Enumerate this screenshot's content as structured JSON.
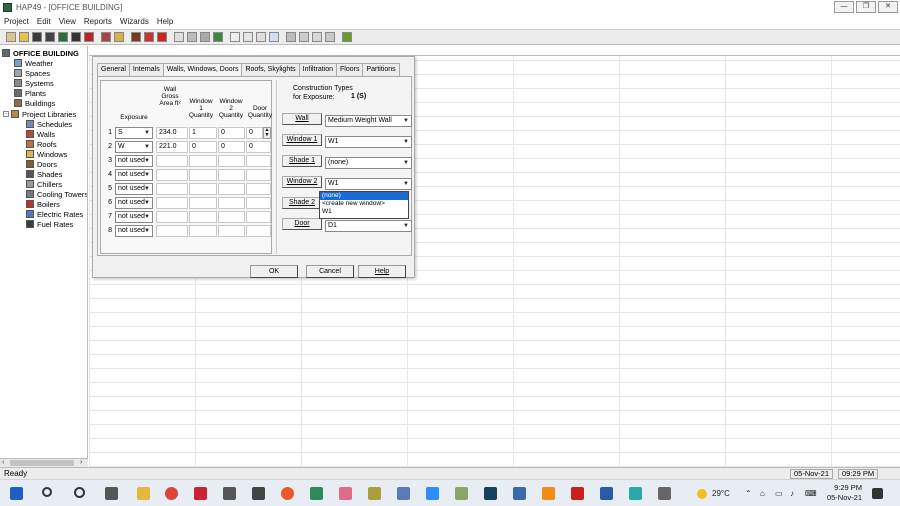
{
  "window": {
    "title": "HAP49 - [OFFICE BUILDING]",
    "min": "—",
    "max": "❐",
    "close": "✕"
  },
  "menu": [
    "Project",
    "Edit",
    "View",
    "Reports",
    "Wizards",
    "Help"
  ],
  "tree": {
    "root": "OFFICE BUILDING",
    "items": [
      "Weather",
      "Spaces",
      "Systems",
      "Plants",
      "Buildings"
    ],
    "libraries_label": "Project Libraries",
    "library_items": [
      "Schedules",
      "Walls",
      "Roofs",
      "Windows",
      "Doors",
      "Shades",
      "Chillers",
      "Cooling Towers",
      "Boilers",
      "Electric Rates",
      "Fuel Rates"
    ]
  },
  "dialog": {
    "tabs": [
      "General",
      "Internals",
      "Walls, Windows, Doors",
      "Roofs, Skylights",
      "Infiltration",
      "Floors",
      "Partitions"
    ],
    "headers": {
      "exposure": "Exposure",
      "wall_area": "Wall Gross Area ft²",
      "window1": "Window 1 Quantity",
      "window2": "Window 2 Quantity",
      "door": "Door Quantity"
    },
    "rows": [
      {
        "num": "1",
        "exposure": "S",
        "area": "234.0",
        "w1": "1",
        "w2": "0",
        "door": "0"
      },
      {
        "num": "2",
        "exposure": "W",
        "area": "221.0",
        "w1": "0",
        "w2": "0",
        "door": "0"
      },
      {
        "num": "3",
        "exposure": "not used",
        "area": "",
        "w1": "",
        "w2": "",
        "door": ""
      },
      {
        "num": "4",
        "exposure": "not used",
        "area": "",
        "w1": "",
        "w2": "",
        "door": ""
      },
      {
        "num": "5",
        "exposure": "not used",
        "area": "",
        "w1": "",
        "w2": "",
        "door": ""
      },
      {
        "num": "6",
        "exposure": "not used",
        "area": "",
        "w1": "",
        "w2": "",
        "door": ""
      },
      {
        "num": "7",
        "exposure": "not used",
        "area": "",
        "w1": "",
        "w2": "",
        "door": ""
      },
      {
        "num": "8",
        "exposure": "not used",
        "area": "",
        "w1": "",
        "w2": "",
        "door": ""
      }
    ],
    "construction": {
      "title_line1": "Construction Types",
      "title_line2": "for Exposure:",
      "exposure_value": "1 (S)",
      "fields": [
        {
          "label": "Wall",
          "value": "Medium Weight Wall"
        },
        {
          "label": "Window 1",
          "value": "W1"
        },
        {
          "label": "Shade 1",
          "value": "(none)"
        },
        {
          "label": "Window 2",
          "value": "W1"
        },
        {
          "label": "Shade 2",
          "value": ""
        },
        {
          "label": "Door",
          "value": "D1"
        }
      ],
      "dropdown_options": [
        "(none)",
        "<create new window>",
        "W1"
      ]
    },
    "buttons": {
      "ok": "OK",
      "cancel": "Cancel",
      "help": "Help"
    }
  },
  "status": {
    "text": "Ready",
    "date": "05-Nov-21",
    "time": "09:29 PM"
  },
  "taskbar": {
    "weather": "29°C",
    "clock_time": "9:29 PM",
    "clock_date": "05-Nov-21"
  }
}
